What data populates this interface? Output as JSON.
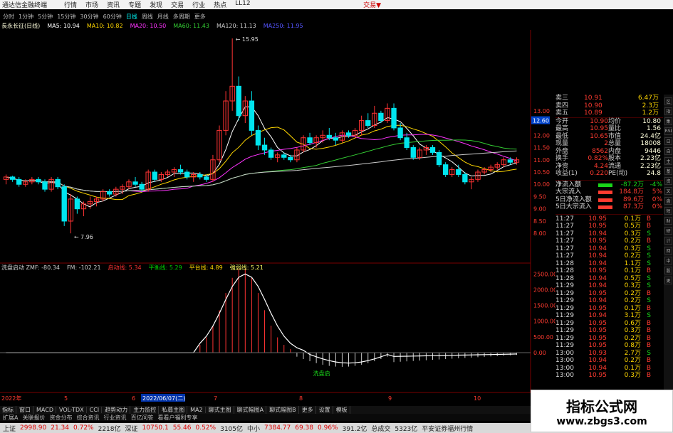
{
  "titlebar": {
    "app": "通达信金融终端",
    "menu": [
      "行情",
      "市场",
      "资讯",
      "专题",
      "发现",
      "交易",
      "行业",
      "热点",
      "LL12"
    ],
    "right": "交易▼"
  },
  "period_bar": {
    "items": [
      "分时",
      "1分钟",
      "5分钟",
      "15分钟",
      "30分钟",
      "60分钟",
      "日线",
      "周线",
      "月线",
      "多周期",
      "更多"
    ],
    "selected": "日线"
  },
  "main_legend": {
    "name": "長永长征(日线)",
    "items": [
      {
        "label": "MA5: 10.94",
        "color": "#ffffff"
      },
      {
        "label": "MA10: 10.82",
        "color": "#ffd700"
      },
      {
        "label": "MA20: 10.50",
        "color": "#ff33ff"
      },
      {
        "label": "MA60: 11.43",
        "color": "#33cc33"
      },
      {
        "label": "MA120: 11.13",
        "color": "#cccccc"
      },
      {
        "label": "MA250: 11.95",
        "color": "#5555ff"
      }
    ]
  },
  "sub_legend": {
    "items": [
      {
        "label": "洗盘启动 ZMF: -80.34",
        "color": "#cccccc"
      },
      {
        "label": "FM: -102.21",
        "color": "#cccccc"
      },
      {
        "label": "启动线: 5.34",
        "color": "#ff3333"
      },
      {
        "label": "平衡线: 5.29",
        "color": "#00cc00"
      },
      {
        "label": "平台线: 4.89",
        "color": "#ffd700"
      },
      {
        "label": "強弱线: 5.21",
        "color": "#ffff66"
      }
    ]
  },
  "chart_data": [
    {
      "type": "candlestick",
      "title": "",
      "yaxis_ticks": [
        13.0,
        12.6,
        12.0,
        11.5,
        11.0,
        10.5,
        10.0,
        9.5,
        9.0,
        8.5,
        8.0
      ],
      "annotations": [
        {
          "label": "15.95"
        },
        {
          "label": "7.96"
        }
      ],
      "last_price_marker": "12.60",
      "bars": [
        [
          10.2,
          10.4,
          10.0,
          10.3
        ],
        [
          10.3,
          10.35,
          10.1,
          10.2
        ],
        [
          10.2,
          10.3,
          9.9,
          10.0
        ],
        [
          10.0,
          10.2,
          9.9,
          10.1
        ],
        [
          10.1,
          10.3,
          10.0,
          10.2
        ],
        [
          10.2,
          10.3,
          10.0,
          10.1
        ],
        [
          10.1,
          10.2,
          9.7,
          9.8
        ],
        [
          9.8,
          10.3,
          9.7,
          10.2
        ],
        [
          10.2,
          10.3,
          9.8,
          9.9
        ],
        [
          9.9,
          10.0,
          8.3,
          8.5
        ],
        [
          8.5,
          9.6,
          8.0,
          9.4
        ],
        [
          9.4,
          9.5,
          8.8,
          9.0
        ],
        [
          9.0,
          9.3,
          8.7,
          9.2
        ],
        [
          9.2,
          9.5,
          9.0,
          9.3
        ],
        [
          9.3,
          9.5,
          9.1,
          9.4
        ],
        [
          9.4,
          9.8,
          9.3,
          9.7
        ],
        [
          9.7,
          9.8,
          9.5,
          9.6
        ],
        [
          9.6,
          9.9,
          9.5,
          9.8
        ],
        [
          9.8,
          10.0,
          9.6,
          9.9
        ],
        [
          9.9,
          10.2,
          9.8,
          10.1
        ],
        [
          10.1,
          10.3,
          9.9,
          10.0
        ],
        [
          10.0,
          10.1,
          9.7,
          9.8
        ],
        [
          9.8,
          10.6,
          9.7,
          10.5
        ],
        [
          10.5,
          10.6,
          10.1,
          10.2
        ],
        [
          10.2,
          10.5,
          10.1,
          10.4
        ],
        [
          10.4,
          10.6,
          10.3,
          10.5
        ],
        [
          10.5,
          10.7,
          10.3,
          10.6
        ],
        [
          10.6,
          10.8,
          10.4,
          10.5
        ],
        [
          10.5,
          10.6,
          10.2,
          10.3
        ],
        [
          10.3,
          10.5,
          10.1,
          10.4
        ],
        [
          10.4,
          10.5,
          10.2,
          10.3
        ],
        [
          10.3,
          10.4,
          10.1,
          10.2
        ],
        [
          10.2,
          11.2,
          10.1,
          11.0
        ],
        [
          11.0,
          12.4,
          10.9,
          12.2
        ],
        [
          12.2,
          13.8,
          12.0,
          13.4
        ],
        [
          13.4,
          15.95,
          13.0,
          14.0
        ],
        [
          14.0,
          14.4,
          12.6,
          12.8
        ],
        [
          12.8,
          13.6,
          12.5,
          13.4
        ],
        [
          13.4,
          13.8,
          12.0,
          12.2
        ],
        [
          12.2,
          12.4,
          11.4,
          11.6
        ],
        [
          11.6,
          11.9,
          11.2,
          11.4
        ],
        [
          11.4,
          11.5,
          11.0,
          11.1
        ],
        [
          11.1,
          11.3,
          10.9,
          11.2
        ],
        [
          11.2,
          11.3,
          11.0,
          11.1
        ],
        [
          11.1,
          11.2,
          10.9,
          11.0
        ],
        [
          11.0,
          11.5,
          10.9,
          11.4
        ],
        [
          11.4,
          12.0,
          11.3,
          11.9
        ],
        [
          11.9,
          12.1,
          11.6,
          11.7
        ],
        [
          11.7,
          12.0,
          11.5,
          11.9
        ],
        [
          11.9,
          12.2,
          11.7,
          12.0
        ],
        [
          12.0,
          12.3,
          11.8,
          11.9
        ],
        [
          11.9,
          12.1,
          11.6,
          11.8
        ],
        [
          11.8,
          12.2,
          11.7,
          12.1
        ],
        [
          12.1,
          12.2,
          11.9,
          12.0
        ],
        [
          12.0,
          12.3,
          11.9,
          12.2
        ],
        [
          12.2,
          12.8,
          12.0,
          12.6
        ],
        [
          12.6,
          12.9,
          12.3,
          12.4
        ],
        [
          12.4,
          13.2,
          12.3,
          12.9
        ],
        [
          12.9,
          13.0,
          12.5,
          12.6
        ],
        [
          12.6,
          13.3,
          12.5,
          13.1
        ],
        [
          13.1,
          13.3,
          12.2,
          12.3
        ],
        [
          12.3,
          12.5,
          11.8,
          11.9
        ],
        [
          11.9,
          12.1,
          11.4,
          11.5
        ],
        [
          11.5,
          11.6,
          11.0,
          11.1
        ],
        [
          11.1,
          11.5,
          11.0,
          11.4
        ],
        [
          11.4,
          11.6,
          11.2,
          11.5
        ],
        [
          11.5,
          11.6,
          11.2,
          11.3
        ],
        [
          11.3,
          11.4,
          10.7,
          10.8
        ],
        [
          10.8,
          10.9,
          10.3,
          10.4
        ],
        [
          10.4,
          10.7,
          10.3,
          10.6
        ],
        [
          10.6,
          10.8,
          10.3,
          10.4
        ],
        [
          10.4,
          10.5,
          10.0,
          10.1
        ],
        [
          10.1,
          10.3,
          9.8,
          10.2
        ],
        [
          10.2,
          10.6,
          10.1,
          10.5
        ],
        [
          10.5,
          10.7,
          10.4,
          10.6
        ],
        [
          10.6,
          10.8,
          10.5,
          10.7
        ],
        [
          10.7,
          10.9,
          10.6,
          10.8
        ],
        [
          10.8,
          11.1,
          10.7,
          11.0
        ],
        [
          11.0,
          11.1,
          10.8,
          10.9
        ],
        [
          10.9,
          11.1,
          10.8,
          11.0
        ]
      ]
    },
    {
      "type": "bar",
      "title": "",
      "yaxis_ticks": [
        2500.0,
        2000.0,
        1500.0,
        1000.0,
        500.0,
        0.0
      ],
      "note": "indicator histogram with white smoothing curve",
      "peak_label": "洗盘启"
    }
  ],
  "quote_panel": {
    "asks": [
      {
        "label": "卖三",
        "price": "10.91",
        "vol": "6.47万"
      },
      {
        "label": "卖四",
        "price": "10.90",
        "vol": "2.3万"
      },
      {
        "label": "卖五",
        "price": "10.89",
        "vol": "1.2万"
      }
    ],
    "stats": [
      [
        "今开",
        "10.90",
        "均价",
        "10.80"
      ],
      [
        "最高",
        "10.95",
        "量比",
        "1.56"
      ],
      [
        "最低",
        "10.65",
        "市值",
        "24.4亿"
      ],
      [
        "现量",
        "2",
        "总量",
        "18008"
      ],
      [
        "外盘",
        "8562",
        "内盘",
        "9446"
      ],
      [
        "换手",
        "0.82%",
        "股本",
        "2.23亿"
      ],
      [
        "净资",
        "4.24",
        "流通",
        "2.23亿"
      ],
      [
        "收益(1)",
        "0.220",
        "PE(动)",
        "24.8"
      ]
    ],
    "flows": [
      {
        "label": "净流入额",
        "val": "-87.2万",
        "pct": "-4%",
        "color": "#19d419"
      },
      {
        "label": "大宗流入",
        "val": "184.8万",
        "pct": "5%",
        "color": "#ff3b30"
      },
      {
        "label": "5日净流入额",
        "val": "89.6万",
        "pct": "0%",
        "color": "#ff3b30"
      },
      {
        "label": "5日大宗流入",
        "val": "87.3万",
        "pct": "0%",
        "color": "#ff3b30"
      }
    ],
    "ticks": [
      [
        "11:27",
        "10.95",
        "0.1万",
        "B"
      ],
      [
        "11:27",
        "10.95",
        "0.5万",
        "B"
      ],
      [
        "11:27",
        "10.94",
        "0.3万",
        "S"
      ],
      [
        "11:27",
        "10.95",
        "0.2万",
        "B"
      ],
      [
        "11:27",
        "10.94",
        "0.3万",
        "S"
      ],
      [
        "11:27",
        "10.94",
        "0.2万",
        "S"
      ],
      [
        "11:28",
        "10.94",
        "1.1万",
        "S"
      ],
      [
        "11:28",
        "10.95",
        "0.1万",
        "B"
      ],
      [
        "11:28",
        "10.94",
        "0.5万",
        "S"
      ],
      [
        "11:29",
        "10.94",
        "0.3万",
        "S"
      ],
      [
        "11:29",
        "10.95",
        "0.2万",
        "B"
      ],
      [
        "11:29",
        "10.94",
        "0.2万",
        "S"
      ],
      [
        "11:29",
        "10.95",
        "0.1万",
        "B"
      ],
      [
        "11:29",
        "10.94",
        "3.1万",
        "S"
      ],
      [
        "11:29",
        "10.95",
        "0.6万",
        "B"
      ],
      [
        "11:29",
        "10.95",
        "0.3万",
        "B"
      ],
      [
        "11:29",
        "10.95",
        "0.2万",
        "B"
      ],
      [
        "11:29",
        "10.95",
        "0.8万",
        "B"
      ],
      [
        "13:00",
        "10.93",
        "2.7万",
        "S"
      ],
      [
        "13:00",
        "10.94",
        "0.2万",
        "B"
      ],
      [
        "13:00",
        "10.94",
        "0.1万",
        "B"
      ],
      [
        "13:00",
        "10.95",
        "0.3万",
        "B"
      ]
    ]
  },
  "side_toolbar": [
    "区",
    "指",
    "集",
    "RSI",
    "日",
    "自",
    "主",
    "基",
    "资",
    "叉",
    "盘",
    "短",
    "财",
    "研",
    "计",
    "回",
    "中",
    "股",
    "更"
  ],
  "xaxis": {
    "labels": [
      "2022年",
      "5",
      "6",
      "2022/06/07(二)",
      "7",
      "8",
      "9",
      "10"
    ]
  },
  "bottom_tabs": [
    "指标",
    "窗口",
    "MACD",
    "VOL-TDX",
    "CCI",
    "趋势动力",
    "主力监控",
    "私募主图",
    "MA2",
    "聊式主图",
    "聊式幅图A",
    "聊式幅图B",
    "更多",
    "设置",
    "模板"
  ],
  "bottom_tabs2": [
    "扩展A",
    "关联报价",
    "资金分布",
    "综合资讯",
    "行业资讯",
    "百亿问答",
    "看看户福利专享"
  ],
  "status": {
    "items": [
      {
        "t": "上证",
        "c": "#222"
      },
      {
        "t": "2998.90",
        "c": "#d00"
      },
      {
        "t": "21.34",
        "c": "#d00"
      },
      {
        "t": "0.72%",
        "c": "#d00"
      },
      {
        "t": "2218亿",
        "c": "#222"
      },
      {
        "t": "深证",
        "c": "#222"
      },
      {
        "t": "10750.1",
        "c": "#d00"
      },
      {
        "t": "55.46",
        "c": "#d00"
      },
      {
        "t": "0.52%",
        "c": "#d00"
      },
      {
        "t": "3105亿",
        "c": "#222"
      },
      {
        "t": "中小",
        "c": "#222"
      },
      {
        "t": "7384.77",
        "c": "#d00"
      },
      {
        "t": "69.38",
        "c": "#d00"
      },
      {
        "t": "0.96%",
        "c": "#d00"
      },
      {
        "t": "391.2亿",
        "c": "#222"
      },
      {
        "t": "总成交",
        "c": "#222"
      },
      {
        "t": "5323亿",
        "c": "#222"
      },
      {
        "t": "平安证券福州行情",
        "c": "#222"
      }
    ]
  },
  "watermark": {
    "line1": "指标公式网",
    "line2": "www.zbgs3.com"
  }
}
